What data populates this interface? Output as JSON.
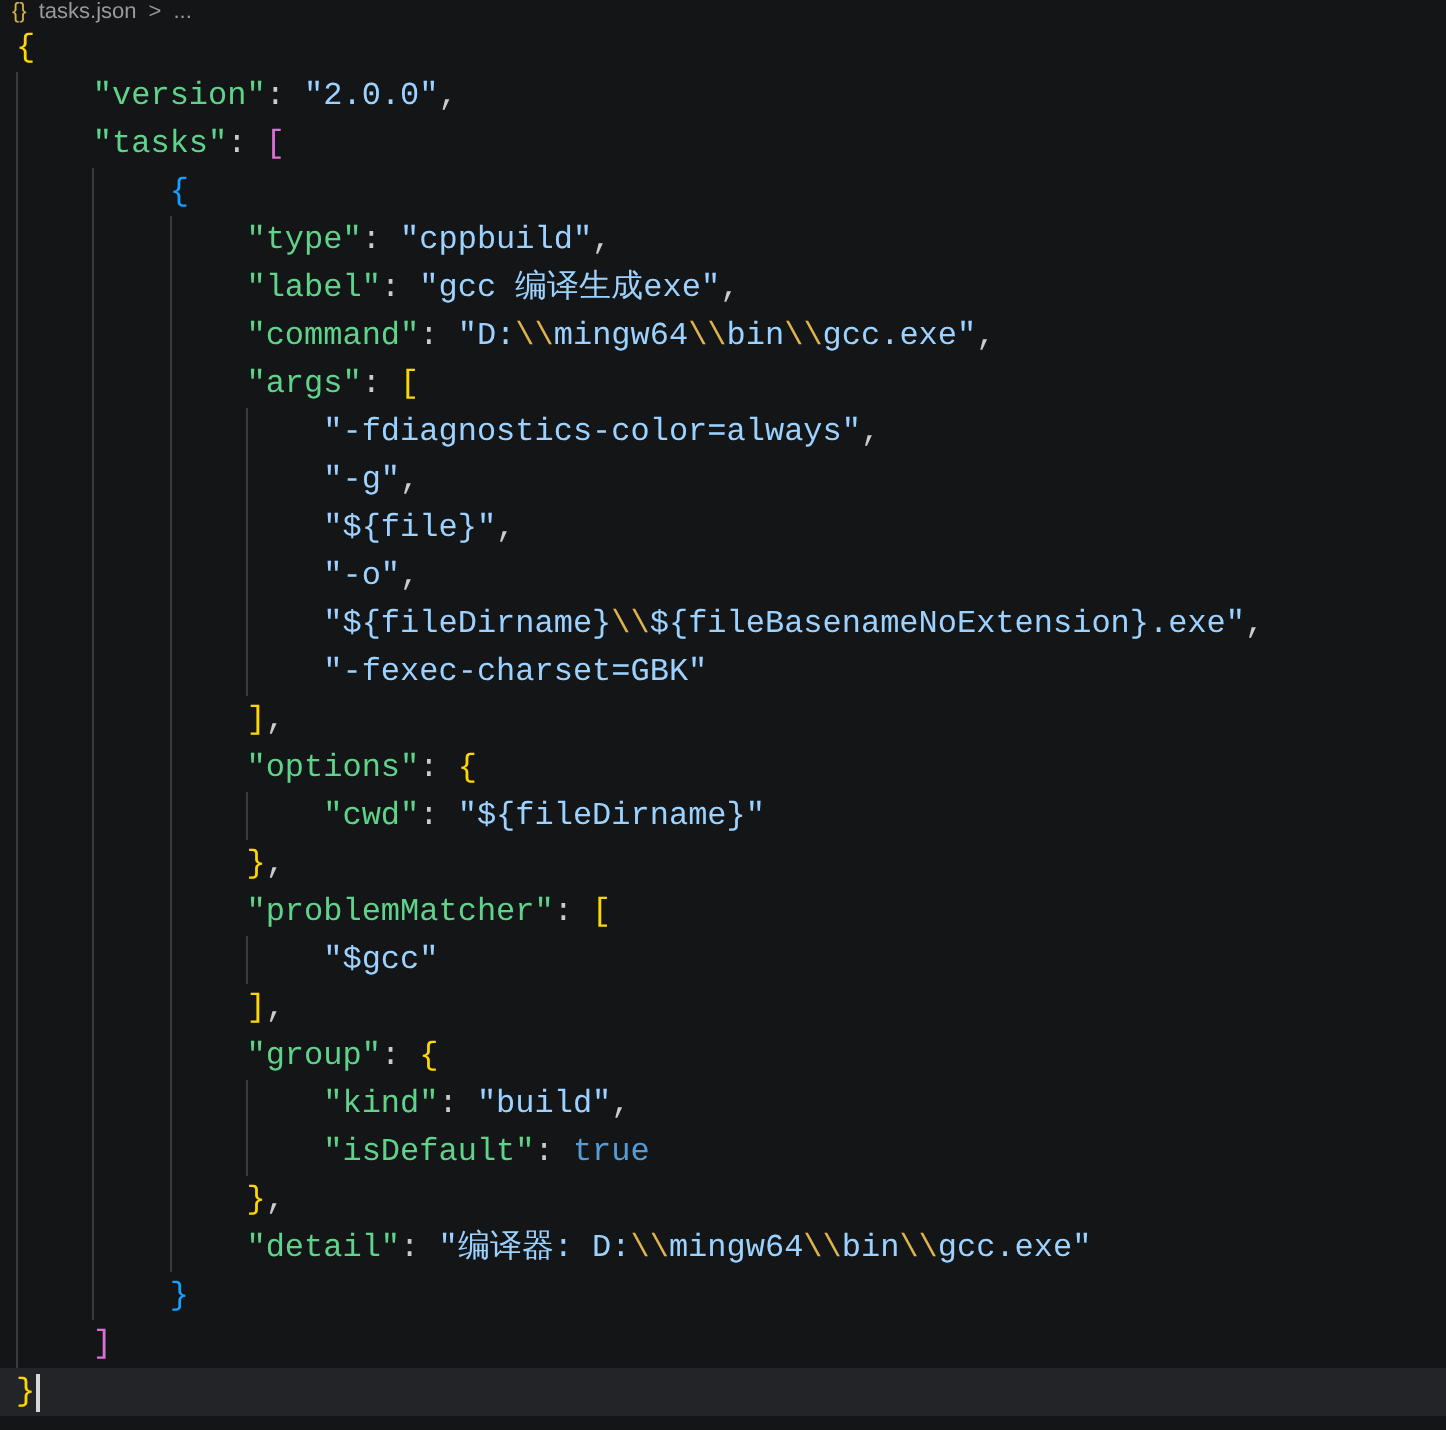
{
  "breadcrumb": {
    "icon": "{}",
    "file": "tasks.json",
    "separator": ">",
    "rest": "..."
  },
  "editor": {
    "lines": [
      {
        "current": false,
        "tokens": [
          {
            "kind": "bracket",
            "text": "{",
            "color": "#ffd700"
          }
        ],
        "children": [
          {
            "current": false,
            "tokens": [
              {
                "kind": "key",
                "text": "\"version\""
              },
              {
                "kind": "punct",
                "text": ": "
              },
              {
                "kind": "string",
                "text": "\"2.0.0\""
              },
              {
                "kind": "punct",
                "text": ","
              }
            ]
          },
          {
            "current": false,
            "tokens": [
              {
                "kind": "key",
                "text": "\"tasks\""
              },
              {
                "kind": "punct",
                "text": ": "
              },
              {
                "kind": "bracket",
                "text": "[",
                "color": "#da70d6"
              }
            ],
            "children": [
              {
                "current": false,
                "tokens": [
                  {
                    "kind": "bracket",
                    "text": "{",
                    "color": "#179fff"
                  }
                ],
                "children": [
                  {
                    "current": false,
                    "tokens": [
                      {
                        "kind": "key",
                        "text": "\"type\""
                      },
                      {
                        "kind": "punct",
                        "text": ": "
                      },
                      {
                        "kind": "string",
                        "text": "\"cppbuild\""
                      },
                      {
                        "kind": "punct",
                        "text": ","
                      }
                    ]
                  },
                  {
                    "current": false,
                    "tokens": [
                      {
                        "kind": "key",
                        "text": "\"label\""
                      },
                      {
                        "kind": "punct",
                        "text": ": "
                      },
                      {
                        "kind": "string",
                        "text": "\"gcc 编译生成exe\""
                      },
                      {
                        "kind": "punct",
                        "text": ","
                      }
                    ]
                  },
                  {
                    "current": false,
                    "tokens": [
                      {
                        "kind": "key",
                        "text": "\"command\""
                      },
                      {
                        "kind": "punct",
                        "text": ": "
                      },
                      {
                        "kind": "string",
                        "text": "\"D:"
                      },
                      {
                        "kind": "escape",
                        "text": "\\\\"
                      },
                      {
                        "kind": "string",
                        "text": "mingw64"
                      },
                      {
                        "kind": "escape",
                        "text": "\\\\"
                      },
                      {
                        "kind": "string",
                        "text": "bin"
                      },
                      {
                        "kind": "escape",
                        "text": "\\\\"
                      },
                      {
                        "kind": "string",
                        "text": "gcc.exe\""
                      },
                      {
                        "kind": "punct",
                        "text": ","
                      }
                    ]
                  },
                  {
                    "current": false,
                    "tokens": [
                      {
                        "kind": "key",
                        "text": "\"args\""
                      },
                      {
                        "kind": "punct",
                        "text": ": "
                      },
                      {
                        "kind": "bracket",
                        "text": "[",
                        "color": "#ffd700"
                      }
                    ],
                    "children": [
                      {
                        "current": false,
                        "tokens": [
                          {
                            "kind": "string",
                            "text": "\"-fdiagnostics-color=always\""
                          },
                          {
                            "kind": "punct",
                            "text": ","
                          }
                        ]
                      },
                      {
                        "current": false,
                        "tokens": [
                          {
                            "kind": "string",
                            "text": "\"-g\""
                          },
                          {
                            "kind": "punct",
                            "text": ","
                          }
                        ]
                      },
                      {
                        "current": false,
                        "tokens": [
                          {
                            "kind": "string",
                            "text": "\"${file}\""
                          },
                          {
                            "kind": "punct",
                            "text": ","
                          }
                        ]
                      },
                      {
                        "current": false,
                        "tokens": [
                          {
                            "kind": "string",
                            "text": "\"-o\""
                          },
                          {
                            "kind": "punct",
                            "text": ","
                          }
                        ]
                      },
                      {
                        "current": false,
                        "tokens": [
                          {
                            "kind": "string",
                            "text": "\"${fileDirname}"
                          },
                          {
                            "kind": "escape",
                            "text": "\\\\"
                          },
                          {
                            "kind": "string",
                            "text": "${fileBasenameNoExtension}.exe\""
                          },
                          {
                            "kind": "punct",
                            "text": ","
                          }
                        ]
                      },
                      {
                        "current": false,
                        "tokens": [
                          {
                            "kind": "string",
                            "text": "\"-fexec-charset=GBK\""
                          }
                        ]
                      }
                    ]
                  },
                  {
                    "current": false,
                    "tokens": [
                      {
                        "kind": "bracket",
                        "text": "]",
                        "color": "#ffd700"
                      },
                      {
                        "kind": "punct",
                        "text": ","
                      }
                    ]
                  },
                  {
                    "current": false,
                    "tokens": [
                      {
                        "kind": "key",
                        "text": "\"options\""
                      },
                      {
                        "kind": "punct",
                        "text": ": "
                      },
                      {
                        "kind": "bracket",
                        "text": "{",
                        "color": "#ffd700"
                      }
                    ],
                    "children": [
                      {
                        "current": false,
                        "tokens": [
                          {
                            "kind": "key",
                            "text": "\"cwd\""
                          },
                          {
                            "kind": "punct",
                            "text": ": "
                          },
                          {
                            "kind": "string",
                            "text": "\"${fileDirname}\""
                          }
                        ]
                      }
                    ]
                  },
                  {
                    "current": false,
                    "tokens": [
                      {
                        "kind": "bracket",
                        "text": "}",
                        "color": "#ffd700"
                      },
                      {
                        "kind": "punct",
                        "text": ","
                      }
                    ]
                  },
                  {
                    "current": false,
                    "tokens": [
                      {
                        "kind": "key",
                        "text": "\"problemMatcher\""
                      },
                      {
                        "kind": "punct",
                        "text": ": "
                      },
                      {
                        "kind": "bracket",
                        "text": "[",
                        "color": "#ffd700"
                      }
                    ],
                    "children": [
                      {
                        "current": false,
                        "tokens": [
                          {
                            "kind": "string",
                            "text": "\"$gcc\""
                          }
                        ]
                      }
                    ]
                  },
                  {
                    "current": false,
                    "tokens": [
                      {
                        "kind": "bracket",
                        "text": "]",
                        "color": "#ffd700"
                      },
                      {
                        "kind": "punct",
                        "text": ","
                      }
                    ]
                  },
                  {
                    "current": false,
                    "tokens": [
                      {
                        "kind": "key",
                        "text": "\"group\""
                      },
                      {
                        "kind": "punct",
                        "text": ": "
                      },
                      {
                        "kind": "bracket",
                        "text": "{",
                        "color": "#ffd700"
                      }
                    ],
                    "children": [
                      {
                        "current": false,
                        "tokens": [
                          {
                            "kind": "key",
                            "text": "\"kind\""
                          },
                          {
                            "kind": "punct",
                            "text": ": "
                          },
                          {
                            "kind": "string",
                            "text": "\"build\""
                          },
                          {
                            "kind": "punct",
                            "text": ","
                          }
                        ]
                      },
                      {
                        "current": false,
                        "tokens": [
                          {
                            "kind": "key",
                            "text": "\"isDefault\""
                          },
                          {
                            "kind": "punct",
                            "text": ": "
                          },
                          {
                            "kind": "keyword",
                            "text": "true"
                          }
                        ]
                      }
                    ]
                  },
                  {
                    "current": false,
                    "tokens": [
                      {
                        "kind": "bracket",
                        "text": "}",
                        "color": "#ffd700"
                      },
                      {
                        "kind": "punct",
                        "text": ","
                      }
                    ]
                  },
                  {
                    "current": false,
                    "tokens": [
                      {
                        "kind": "key",
                        "text": "\"detail\""
                      },
                      {
                        "kind": "punct",
                        "text": ": "
                      },
                      {
                        "kind": "string",
                        "text": "\"编译器: D:"
                      },
                      {
                        "kind": "escape",
                        "text": "\\\\"
                      },
                      {
                        "kind": "string",
                        "text": "mingw64"
                      },
                      {
                        "kind": "escape",
                        "text": "\\\\"
                      },
                      {
                        "kind": "string",
                        "text": "bin"
                      },
                      {
                        "kind": "escape",
                        "text": "\\\\"
                      },
                      {
                        "kind": "string",
                        "text": "gcc.exe\""
                      }
                    ]
                  }
                ]
              },
              {
                "current": false,
                "tokens": [
                  {
                    "kind": "bracket",
                    "text": "}",
                    "color": "#179fff"
                  }
                ]
              }
            ]
          },
          {
            "current": false,
            "tokens": [
              {
                "kind": "bracket",
                "text": "]",
                "color": "#da70d6"
              }
            ]
          }
        ]
      },
      {
        "current": true,
        "tokens": [
          {
            "kind": "bracket",
            "text": "}",
            "color": "#ffd700"
          }
        ]
      }
    ]
  }
}
